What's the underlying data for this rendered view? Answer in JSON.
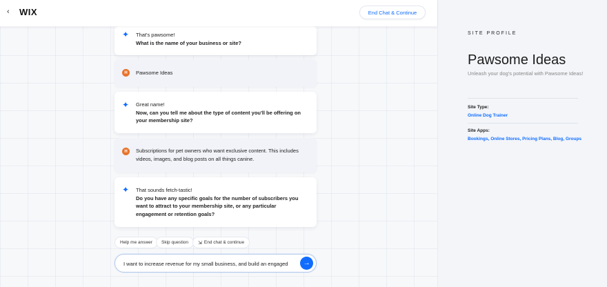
{
  "app": {
    "logo": "WIX",
    "back_glyph": "‹",
    "end_chat_label": "End Chat & Continue"
  },
  "messages": [
    {
      "role": "assistant",
      "lines": [
        "That's pawsome!"
      ],
      "bold_lines": [
        "What is the name of your business or site?"
      ]
    },
    {
      "role": "user",
      "avatar": "H",
      "lines": [
        "Pawsome Ideas"
      ]
    },
    {
      "role": "assistant",
      "lines": [
        "Great name!"
      ],
      "bold_lines": [
        "Now, can you tell me about the type of content you'll be offering on",
        "your membership site?"
      ]
    },
    {
      "role": "user",
      "avatar": "H",
      "lines": [
        "Subscriptions for pet owners who want exclusive content. This includes",
        "videos, images, and blog posts on all things canine."
      ]
    },
    {
      "role": "assistant",
      "lines": [
        "That sounds fetch-tastic!"
      ],
      "bold_lines": [
        "Do you have any specific goals for the number of subscribers you",
        "want to attract to your membership site, or any particular",
        "engagement or retention goals?"
      ]
    }
  ],
  "chips": {
    "help": "Help me answer",
    "skip": "Skip question",
    "end": "End chat & continue"
  },
  "input": {
    "value": "I want to increase revenue for my small business, and build an engaged"
  },
  "profile": {
    "kicker": "SITE PROFILE",
    "title": "Pawsome Ideas",
    "subtitle": "Unleash your dog's potential with Pawsome Ideas!",
    "site_type_label": "Site Type:",
    "site_type_value": "Online Dog Trainer",
    "site_apps_label": "Site Apps:",
    "site_apps_value": "Bookings, Online Stores, Pricing Plans, Blog, Groups"
  },
  "colors": {
    "accent": "#116dff",
    "avatar": "#e8732a"
  }
}
